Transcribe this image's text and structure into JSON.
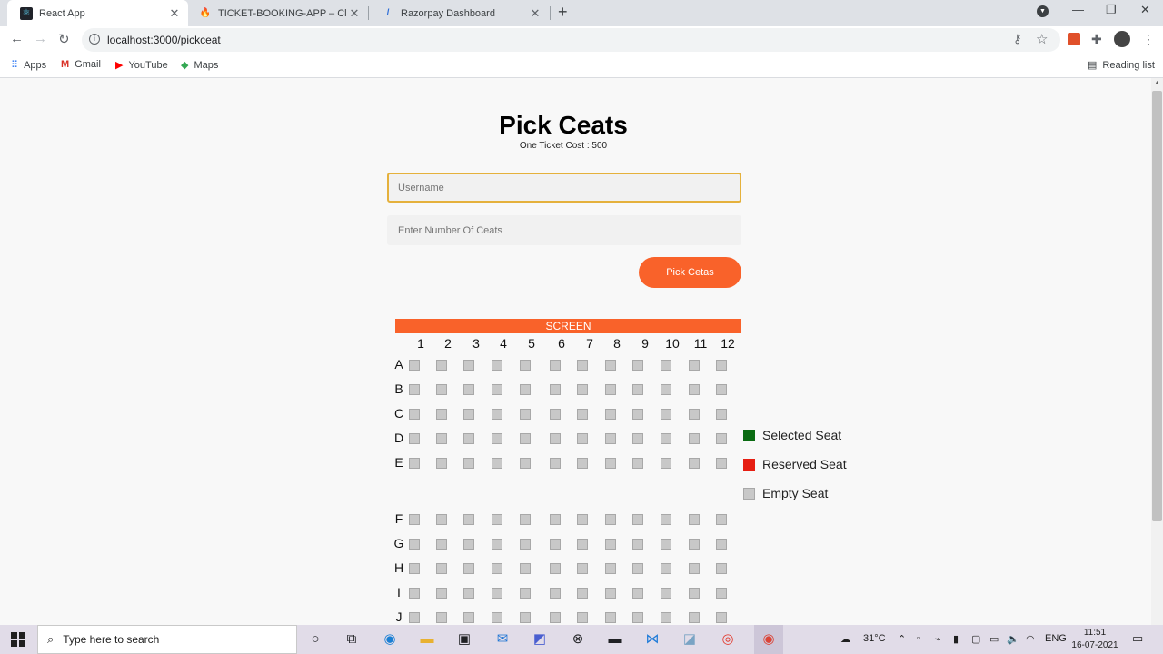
{
  "browser": {
    "tabs": [
      {
        "title": "React App",
        "active": true
      },
      {
        "title": "TICKET-BOOKING-APP – Cloud F",
        "active": false
      },
      {
        "title": "Razorpay Dashboard",
        "active": false
      }
    ],
    "new_tab": "+",
    "url": "localhost:3000/pickceat",
    "bookmarks": [
      "Apps",
      "Gmail",
      "YouTube",
      "Maps"
    ],
    "reading_list": "Reading list"
  },
  "page": {
    "title": "Pick Ceats",
    "subtitle": "One Ticket Cost : 500",
    "username_placeholder": "Username",
    "seats_placeholder": "Enter Number Of Ceats",
    "pick_button": "Pick Cetas",
    "screen_label": "SCREEN",
    "columns": [
      "1",
      "2",
      "3",
      "4",
      "5",
      "6",
      "7",
      "8",
      "9",
      "10",
      "11",
      "12"
    ],
    "rows": [
      "A",
      "B",
      "C",
      "D",
      "E",
      "F",
      "G",
      "H",
      "I",
      "J"
    ],
    "legend": [
      {
        "label": "Selected Seat",
        "color": "#0a6b12"
      },
      {
        "label": "Reserved Seat",
        "color": "#e61e12"
      },
      {
        "label": "Empty Seat",
        "color": "#c8c8c8"
      }
    ]
  },
  "taskbar": {
    "search_placeholder": "Type here to search",
    "weather": "31°C",
    "language": "ENG",
    "time": "11:51",
    "date": "16-07-2021"
  },
  "colors": {
    "accent": "#f9622a",
    "focus_border": "#e5b13c"
  }
}
